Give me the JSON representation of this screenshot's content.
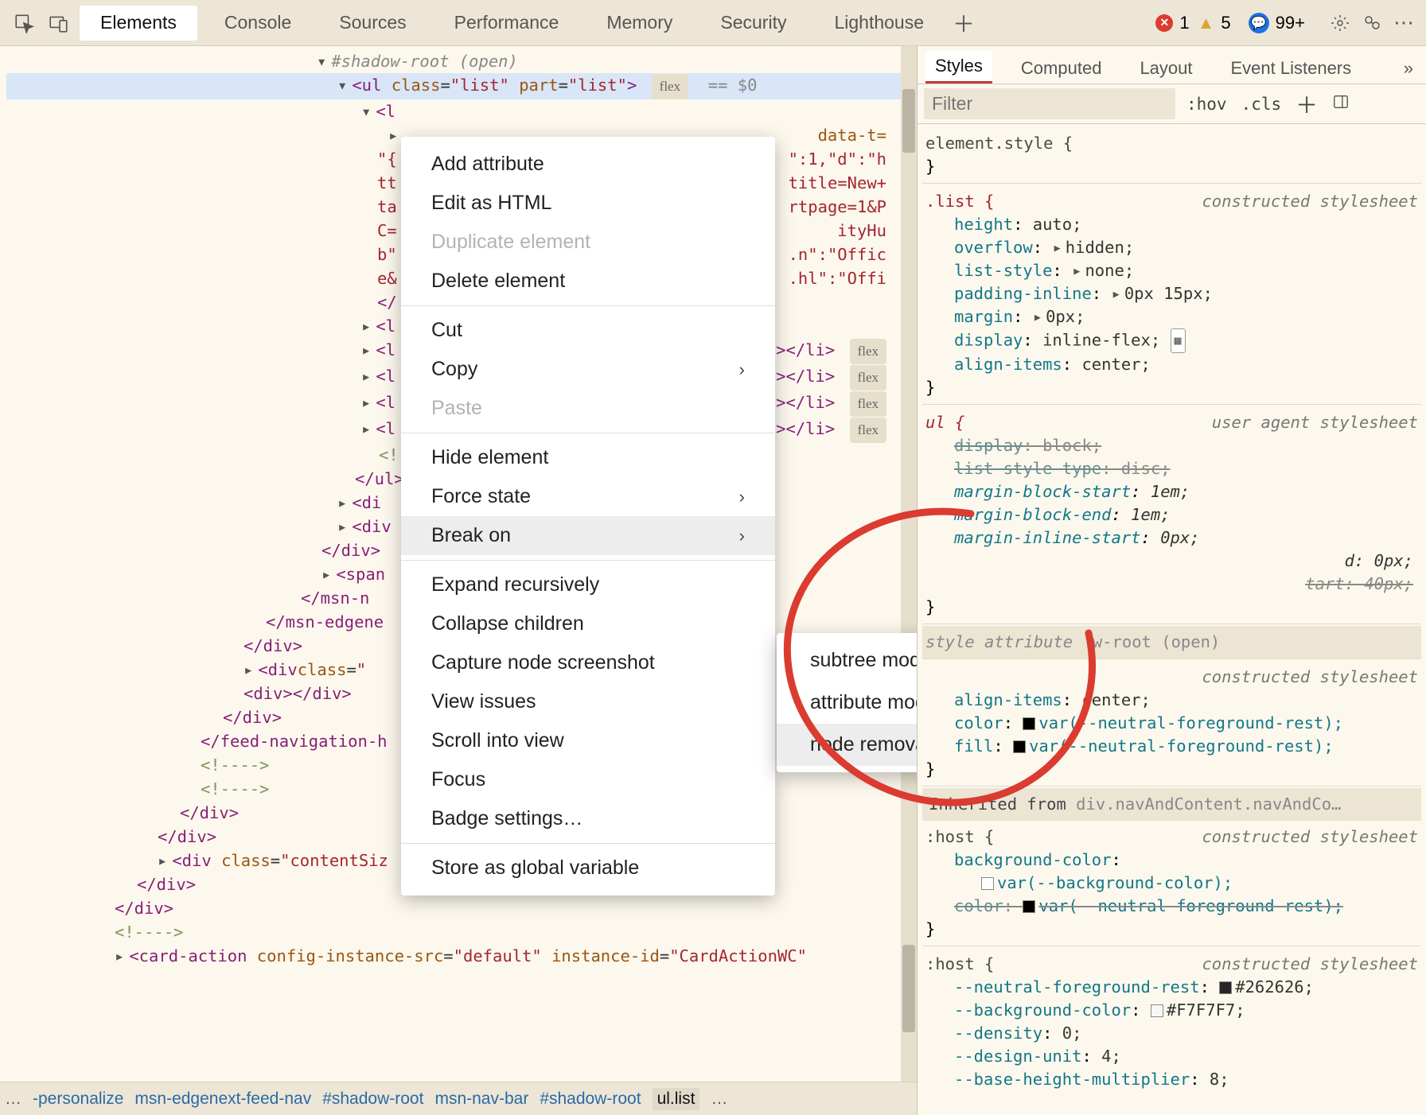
{
  "toolbar": {
    "tabs": [
      "Elements",
      "Console",
      "Sources",
      "Performance",
      "Memory",
      "Security",
      "Lighthouse"
    ],
    "active_tab": 0,
    "error_count": "1",
    "warning_count": "5",
    "issues_count": "99+"
  },
  "styles_tabs": {
    "tabs": [
      "Styles",
      "Computed",
      "Layout",
      "Event Listeners"
    ],
    "active": 0
  },
  "filter": {
    "placeholder": "Filter",
    "hov": ":hov",
    "cls": ".cls"
  },
  "rules": {
    "elstyle": {
      "selector": "element.style {",
      "close": "}"
    },
    "list": {
      "selector": ".list {",
      "sheet": "constructed stylesheet",
      "props": [
        {
          "n": "height",
          "v": "auto;"
        },
        {
          "n": "overflow",
          "v": "hidden;",
          "collapsed": true
        },
        {
          "n": "list-style",
          "v": "none;",
          "collapsed": true
        },
        {
          "n": "padding-inline",
          "v": "0px 15px;",
          "collapsed": true
        },
        {
          "n": "margin",
          "v": "0px;",
          "collapsed": true
        },
        {
          "n": "display",
          "v": "inline-flex;",
          "flex": true
        },
        {
          "n": "align-items",
          "v": "center;"
        }
      ],
      "close": "}"
    },
    "ul": {
      "selector": "ul {",
      "sheet": "user agent stylesheet",
      "props": [
        {
          "n": "display",
          "v": "block;",
          "strike": true
        },
        {
          "n": "list-style-type",
          "v": "disc;",
          "strike": true
        },
        {
          "n": "margin-block-start",
          "v": "1em;"
        },
        {
          "n": "margin-block-end",
          "v": "1em;"
        },
        {
          "n": "margin-inline-start",
          "v": "0px;"
        },
        {
          "n": "margin-inline-end",
          "v": "0px;",
          "cut": "d: 0px;"
        },
        {
          "n": "padding-inline-start",
          "v": "40px;",
          "strike": true,
          "cut": "tart: 40px;"
        }
      ],
      "close": "}"
    },
    "shadowline": "style attribute w-root (open)",
    "cs2": {
      "sheet": "constructed stylesheet",
      "props": [
        {
          "n": "align-items",
          "v": "center;"
        },
        {
          "n": "color",
          "v": "var(--neutral-foreground-rest);",
          "sw": "black"
        },
        {
          "n": "fill",
          "v": "var(--neutral-foreground-rest);",
          "sw": "black"
        }
      ],
      "close": "}"
    },
    "inherit_label": "Inherited from",
    "inherit_sel": "div.navAndContent.navAndCo…",
    "host1": {
      "selector": ":host {",
      "sheet": "constructed stylesheet",
      "props": [
        {
          "n": "background-color",
          "v": ""
        },
        {
          "n": "",
          "v": "var(--background-color);",
          "sw": "white",
          "indent": true
        },
        {
          "n": "color",
          "v": "var(--neutral-foreground-rest);",
          "sw": "black",
          "strike": true
        }
      ],
      "close": "}"
    },
    "host2": {
      "selector": ":host {",
      "sheet": "constructed stylesheet",
      "props": [
        {
          "n": "--neutral-foreground-rest",
          "v": "#262626;",
          "sw": "dark"
        },
        {
          "n": "--background-color",
          "v": "#F7F7F7;",
          "sw": "lt"
        },
        {
          "n": "--density",
          "v": "0;"
        },
        {
          "n": "--design-unit",
          "v": "4;"
        },
        {
          "n": "--base-height-multiplier",
          "v": "8;"
        }
      ]
    }
  },
  "context_menu": {
    "items": [
      {
        "label": "Add attribute"
      },
      {
        "label": "Edit as HTML"
      },
      {
        "label": "Duplicate element",
        "disabled": true
      },
      {
        "label": "Delete element"
      },
      {
        "sep": true
      },
      {
        "label": "Cut"
      },
      {
        "label": "Copy",
        "arrow": true
      },
      {
        "label": "Paste",
        "disabled": true
      },
      {
        "sep": true
      },
      {
        "label": "Hide element"
      },
      {
        "label": "Force state",
        "arrow": true
      },
      {
        "label": "Break on",
        "arrow": true,
        "hover": true
      },
      {
        "sep": true
      },
      {
        "label": "Expand recursively"
      },
      {
        "label": "Collapse children"
      },
      {
        "label": "Capture node screenshot"
      },
      {
        "label": "View issues"
      },
      {
        "label": "Scroll into view"
      },
      {
        "label": "Focus"
      },
      {
        "label": "Badge settings…"
      },
      {
        "sep": true
      },
      {
        "label": "Store as global variable"
      }
    ]
  },
  "submenu": {
    "items": [
      {
        "label": "subtree modifications"
      },
      {
        "label": "attribute modifications"
      },
      {
        "label": "node removal",
        "hover": true
      }
    ]
  },
  "dom": {
    "shadow": "#shadow-root (open)",
    "ul_open": "<ul class=\"list\" part=\"list\">",
    "hint": "== $0",
    "frag_li_open": "<l",
    "frag_data_t": "data-t=",
    "frag_row1": "\"{",
    "frag_row1b": "\":1,\"d\":\"h",
    "frag_row2": "tt",
    "frag_row2b": "title=New+",
    "frag_row3": "ta",
    "frag_row3b": "rtpage=1&P",
    "frag_row4": "C=",
    "frag_row4b": "ityHu",
    "frag_row5": "b\"",
    "frag_row5b": ".n\":\"Offic",
    "frag_row6": "e&",
    "frag_row6b": ".hl\":\"Offi",
    "frag_close_li": "</",
    "li_row": "<l",
    "li_close": "></li>",
    "comment1": "<!",
    "ulclose": "</ul>",
    "div_close": "</di",
    "div_row": "<div",
    "span_row": "<span",
    "msn_close": "</msn-n",
    "msn_edge": "</msn-edgene",
    "feed_close": "</feed-navigation-h",
    "cmt": "<!---->",
    "div_classclose": "<div class=\"",
    "div_contentsize": "<div class=\"contentSiz",
    "expansion1": ">",
    "expansion_end": "v>",
    "card_action": "<card-action config-instance-src=\"default\" instance-id=\"CardActionWC\""
  },
  "breadcrumb": {
    "items": [
      "…",
      "-personalize",
      "msn-edgenext-feed-nav",
      "#shadow-root",
      "msn-nav-bar",
      "#shadow-root",
      "ul.list",
      "…"
    ],
    "active_index": 6
  },
  "colors": {
    "red_annotation": "#db3b30"
  }
}
